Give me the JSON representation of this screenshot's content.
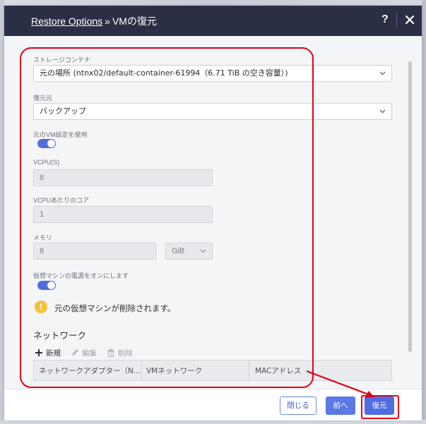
{
  "header": {
    "breadcrumb_link": "Restore Options",
    "separator": "»",
    "title": "VMの復元",
    "help_label": "?"
  },
  "form": {
    "storage_container": {
      "label": "ストレージコンテナ",
      "value": "元の場所 (ntnx02/default-container-61994（6.71 TiB の空き容量）)"
    },
    "restore_source": {
      "label": "復元元",
      "value": "バックアップ"
    },
    "use_original_vm_settings": {
      "label": "元のVM設定を使用",
      "on": true
    },
    "vcpus": {
      "label": "VCPU(S)",
      "value": "8"
    },
    "cores_per_vcpu": {
      "label": "VCPUあたりのコア",
      "value": "1"
    },
    "memory": {
      "label": "メモリ",
      "value": "8",
      "unit": "GiB"
    },
    "power_on_vm": {
      "label": "仮想マシンの電源をオンにします",
      "on": true
    },
    "warning": {
      "icon": "exclamation-icon",
      "text": "元の仮想マシンが削除されます。"
    }
  },
  "network": {
    "title": "ネットワーク",
    "toolbar": {
      "new_label": "新規",
      "edit_label": "編集",
      "delete_label": "削除"
    },
    "columns": [
      "ネットワークアダプター（N...",
      "VMネットワーク",
      "MACアドレス"
    ]
  },
  "footer": {
    "close_label": "閉じる",
    "prev_label": "前へ",
    "restore_label": "復元"
  },
  "colors": {
    "header_bg": "#2b2f46",
    "primary": "#4e6de3",
    "annotation_red": "#e3001b",
    "warning": "#f4c23a"
  }
}
